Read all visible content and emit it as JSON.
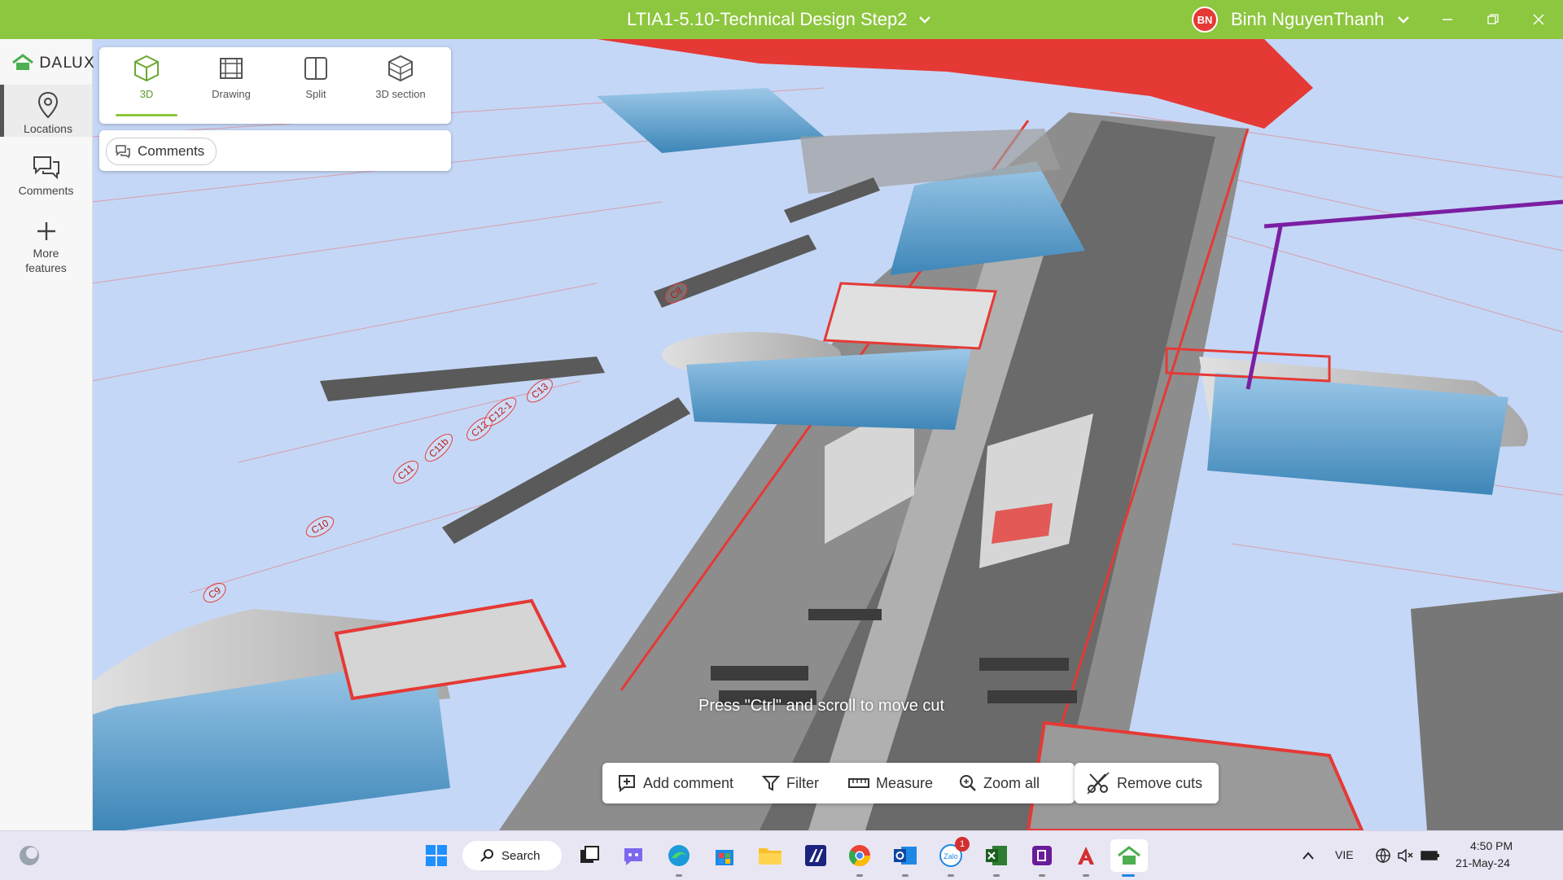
{
  "window": {
    "title": "LTIA1-5.10-Technical Design Step2",
    "user_initials": "BN",
    "user_name": "Binh NguyenThanh",
    "accent_color": "#8dc63f"
  },
  "sidebar": {
    "logo_text": "DALUX",
    "items": [
      {
        "label": "Locations",
        "icon": "location-pin-icon"
      },
      {
        "label": "Comments",
        "icon": "comments-icon"
      },
      {
        "label_line1": "More",
        "label_line2": "features",
        "icon": "plus-icon"
      }
    ]
  },
  "view_modes": [
    {
      "label": "3D",
      "icon": "cube-icon"
    },
    {
      "label": "Drawing",
      "icon": "drawing-icon"
    },
    {
      "label": "Split",
      "icon": "split-icon"
    },
    {
      "label": "3D section",
      "icon": "section-cube-icon"
    }
  ],
  "filter_chip": {
    "label": "Comments"
  },
  "viewport": {
    "hint": "Press \"Ctrl\" and scroll to move cut",
    "gate_labels": [
      "C9",
      "C10",
      "C11",
      "C11b",
      "C12",
      "C12-1",
      "C13",
      "C8"
    ]
  },
  "actions": {
    "add_comment": "Add comment",
    "filter": "Filter",
    "measure": "Measure",
    "zoom_all": "Zoom all",
    "remove_cuts": "Remove cuts"
  },
  "taskbar": {
    "search_label": "Search",
    "zalo_badge": "1",
    "language": "VIE",
    "time": "4:50 PM",
    "date": "21-May-24"
  }
}
